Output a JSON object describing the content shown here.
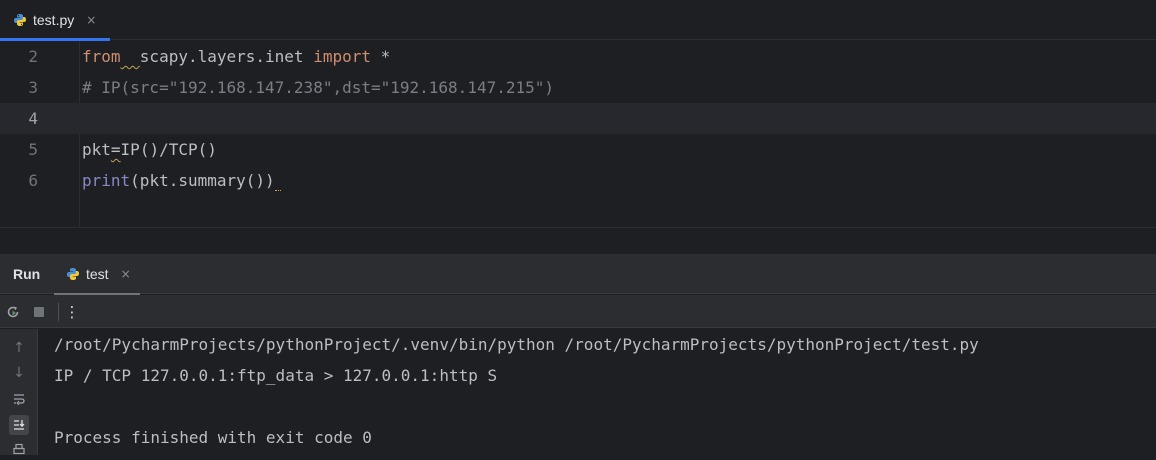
{
  "editor_tab": {
    "label": "test.py",
    "close": "×",
    "icon": "python-file-icon"
  },
  "editor": {
    "lines": [
      {
        "no": "2",
        "tokens": [
          {
            "text": "from",
            "style": "kw",
            "squiggle": false
          },
          {
            "text": "  ",
            "style": "plain",
            "squiggle": true
          },
          {
            "text": "scapy.layers.inet ",
            "style": "plain",
            "squiggle": false
          },
          {
            "text": "import",
            "style": "kw",
            "squiggle": false
          },
          {
            "text": " *",
            "style": "plain",
            "squiggle": false
          }
        ]
      },
      {
        "no": "3",
        "tokens": [
          {
            "text": "# IP(src=\"192.168.147.238\",dst=\"192.168.147.215\")",
            "style": "comment",
            "squiggle": false
          }
        ]
      },
      {
        "no": "4",
        "current": true,
        "tokens": []
      },
      {
        "no": "5",
        "tokens": [
          {
            "text": "pkt",
            "style": "plain",
            "squiggle": false
          },
          {
            "text": "=",
            "style": "plain",
            "squiggle": true
          },
          {
            "text": "IP()/TCP()",
            "style": "plain",
            "squiggle": false
          }
        ]
      },
      {
        "no": "6",
        "tokens": [
          {
            "text": "print",
            "style": "builtin",
            "squiggle": false
          },
          {
            "text": "(pkt.summary())",
            "style": "plain",
            "squiggle": false
          },
          {
            "text": "",
            "style": "plain",
            "squiggle": true
          }
        ]
      }
    ]
  },
  "run_panel": {
    "title": "Run",
    "tab_label": "test",
    "tab_close": "×",
    "toolbar": {
      "rerun_icon": "rerun-icon",
      "stop_icon": "stop-icon",
      "more_icon": "more-vertical-icon",
      "more_label": "⋮"
    },
    "gutter_icons": [
      "up-arrow-icon",
      "down-arrow-icon",
      "soft-wrap-icon",
      "scroll-to-end-icon",
      "print-icon"
    ],
    "gutter_glyphs": {
      "up": "↑",
      "down": "↓"
    },
    "console_lines": [
      "/root/PycharmProjects/pythonProject/.venv/bin/python /root/PycharmProjects/pythonProject/test.py",
      "IP / TCP 127.0.0.1:ftp_data > 127.0.0.1:http S",
      "",
      "Process finished with exit code 0"
    ]
  },
  "colors": {
    "accent": "#3574f0",
    "keyword": "#cf8e6d",
    "comment": "#7a7e85",
    "builtin": "#8888c6"
  }
}
